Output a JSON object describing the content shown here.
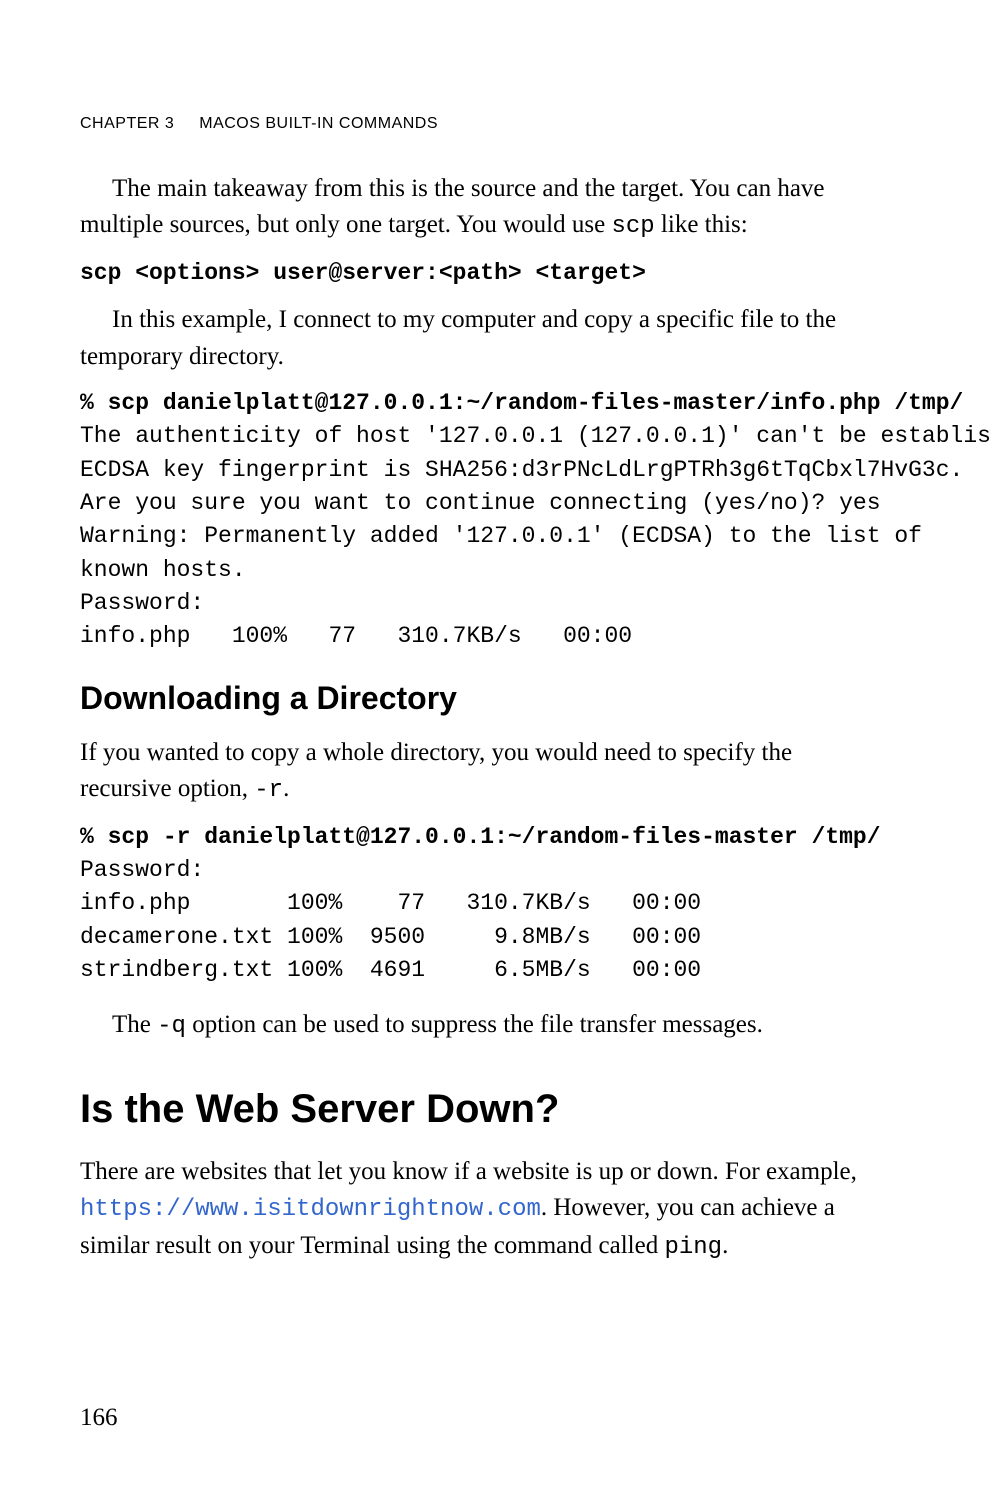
{
  "runningHead": {
    "chapter": "CHAPTER 3",
    "title": "MACOS BUILT-IN COMMANDS"
  },
  "para1a": "The main takeaway from this is the source and the target. You can have multiple sources, but only one target. You would use ",
  "para1b": "scp",
  "para1c": " like this:",
  "codeSyntax": "scp <options> user@server:<path> <target>",
  "para2": "In this example, I connect to my computer and copy a specific file to the temporary directory.",
  "codeBlock1Bold": "% scp danielplatt@127.0.0.1:~/random-files-master/info.php /tmp/",
  "codeBlock1Rest": "The authenticity of host '127.0.0.1 (127.0.0.1)' can't be established.\nECDSA key fingerprint is SHA256:d3rPNcLdLrgPTRh3g6tTqCbxl7HvG3c.\nAre you sure you want to continue connecting (yes/no)? yes\nWarning: Permanently added '127.0.0.1' (ECDSA) to the list of\nknown hosts.\nPassword:\ninfo.php   100%   77   310.7KB/s   00:00",
  "heading1": "Downloading a Directory",
  "para3a": "If you wanted to copy a whole directory, you would need to specify the recursive option, ",
  "para3b": "-r",
  "para3c": ".",
  "codeBlock2Bold": "% scp -r danielplatt@127.0.0.1:~/random-files-master /tmp/",
  "codeBlock2Rest": "Password:\ninfo.php       100%    77   310.7KB/s   00:00\ndecamerone.txt 100%  9500     9.8MB/s   00:00\nstrindberg.txt 100%  4691     6.5MB/s   00:00",
  "para4a": "The ",
  "para4b": "-q",
  "para4c": " option can be used to suppress the file transfer messages.",
  "heading2": "Is the Web Server Down?",
  "para5a": "There are websites that let you know if a website is up or down. For example, ",
  "para5link": "https://www.isitdownrightnow.com",
  "para5b": ". However, you can achieve a similar result on your Terminal using the command called ",
  "para5c": "ping",
  "para5d": ".",
  "pageNumber": "166"
}
